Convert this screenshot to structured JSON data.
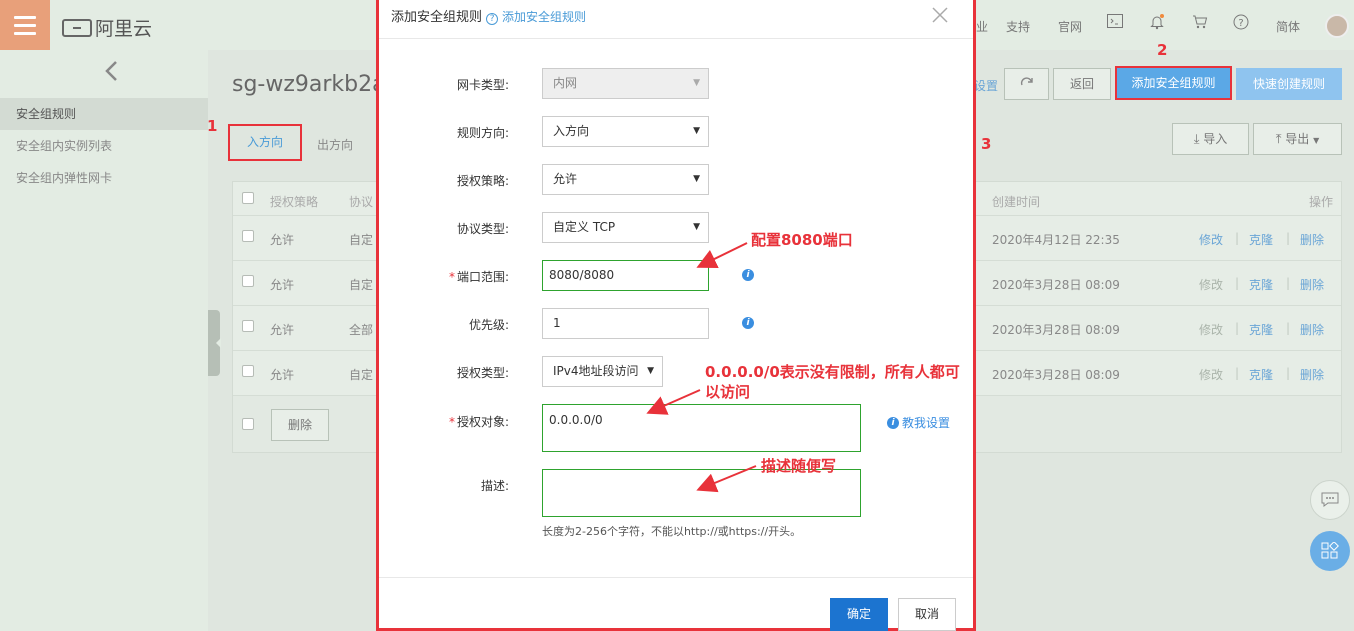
{
  "topbar": {
    "logo_text": "阿里云",
    "links": [
      "业",
      "支持",
      "官网",
      "简体"
    ],
    "icons": [
      "terminal-icon",
      "bell-icon",
      "cart-icon",
      "help-icon"
    ]
  },
  "sidebar": {
    "items": [
      {
        "label": "安全组规则",
        "active": true
      },
      {
        "label": "安全组内实例列表",
        "active": false
      },
      {
        "label": "安全组内弹性网卡",
        "active": false
      }
    ]
  },
  "main": {
    "title": "sg-wz9arkb2a",
    "tabs": [
      {
        "label": "入方向",
        "active": true
      },
      {
        "label": "出方向",
        "active": false
      }
    ],
    "toolbar": {
      "settings_label": "设置",
      "back_label": "返回",
      "add_rule_label": "添加安全组规则",
      "quick_create_label": "快速创建规则",
      "import_label": "导入",
      "export_label": "导出"
    },
    "table": {
      "headers": {
        "policy": "授权策略",
        "protocol": "协议",
        "created": "创建时间",
        "actions": "操作"
      },
      "rows": [
        {
          "policy": "允许",
          "protocol": "自定",
          "created": "2020年4月12日 22:35",
          "edit": "修改",
          "edit_disabled": false,
          "clone": "克隆",
          "delete": "删除"
        },
        {
          "policy": "允许",
          "protocol": "自定",
          "created": "2020年3月28日 08:09",
          "edit": "修改",
          "edit_disabled": true,
          "clone": "克隆",
          "delete": "删除"
        },
        {
          "policy": "允许",
          "protocol": "全部",
          "created": "2020年3月28日 08:09",
          "edit": "修改",
          "edit_disabled": true,
          "clone": "克隆",
          "delete": "删除"
        },
        {
          "policy": "允许",
          "protocol": "自定",
          "created": "2020年3月28日 08:09",
          "edit": "修改",
          "edit_disabled": true,
          "clone": "克隆",
          "delete": "删除"
        }
      ],
      "delete_button": "删除"
    }
  },
  "modal": {
    "title": "添加安全组规则",
    "help_link": "添加安全组规则",
    "fields": {
      "nic_type": {
        "label": "网卡类型:",
        "value": "内网"
      },
      "direction": {
        "label": "规则方向:",
        "value": "入方向"
      },
      "policy": {
        "label": "授权策略:",
        "value": "允许"
      },
      "protocol": {
        "label": "协议类型:",
        "value": "自定义 TCP"
      },
      "port_range": {
        "label": "端口范围:",
        "value": "8080/8080"
      },
      "priority": {
        "label": "优先级:",
        "value": "1"
      },
      "auth_type": {
        "label": "授权类型:",
        "value": "IPv4地址段访问"
      },
      "auth_object": {
        "label": "授权对象:",
        "value": "0.0.0.0/0"
      },
      "description": {
        "label": "描述:",
        "value": ""
      }
    },
    "teach_link": "教我设置",
    "hint": "长度为2-256个字符，不能以http://或https://开头。",
    "ok_label": "确定",
    "cancel_label": "取消"
  },
  "annotations": {
    "step1": "1",
    "step2": "2",
    "step3": "3",
    "port_note": "配置8080端口",
    "auth_note": "0.0.0.0/0表示没有限制，所有人都可以访问",
    "desc_note": "描述随便写"
  },
  "colors": {
    "accent": "#e8323a",
    "primary": "#1c74d0",
    "link": "#4a9bd7",
    "valid": "#2ea32e"
  }
}
